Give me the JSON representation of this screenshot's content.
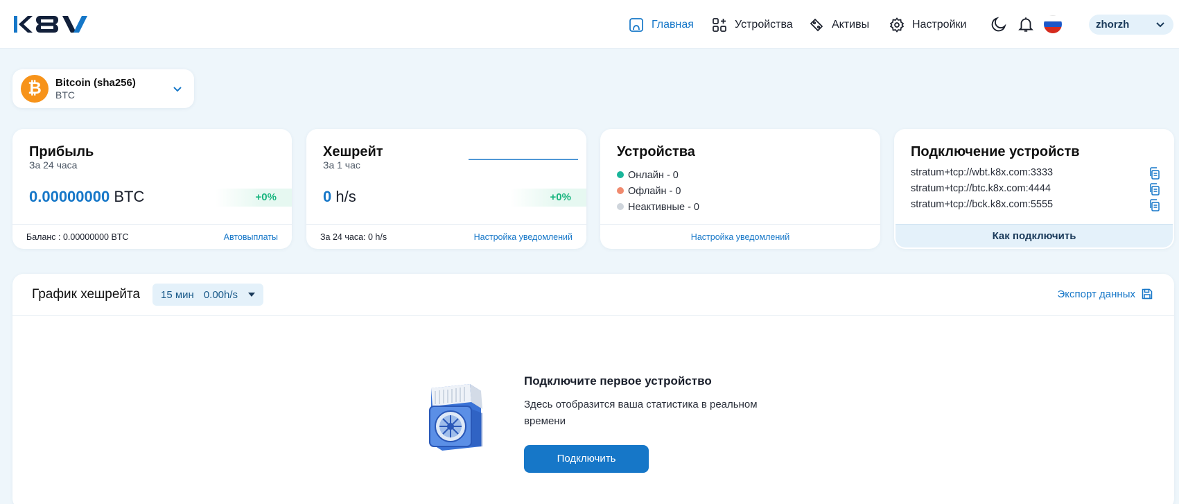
{
  "header": {
    "nav": [
      {
        "label": "Главная",
        "icon": "home-icon",
        "active": true
      },
      {
        "label": "Устройства",
        "icon": "devices-icon"
      },
      {
        "label": "Активы",
        "icon": "assets-icon"
      },
      {
        "label": "Настройки",
        "icon": "gear-icon"
      }
    ],
    "user": "zhorzh",
    "accent": "#1677c8"
  },
  "coin": {
    "name": "Bitcoin (sha256)",
    "ticker": "BTC",
    "color": "#f7931a"
  },
  "profit": {
    "title": "Прибыль",
    "period": "За 24 часа",
    "value": "0.00000000",
    "unit": "BTC",
    "change": "+0%",
    "balance": "Баланс : 0.00000000 BTC",
    "link": "Автовыплаты"
  },
  "hashrate": {
    "title": "Хешрейт",
    "period": "За 1 час",
    "value": "0",
    "unit": "h/s",
    "change": "+0%",
    "day": "За 24 часа: 0 h/s",
    "link": "Настройка уведомлений"
  },
  "devices": {
    "title": "Устройства",
    "online": "Онлайн - 0",
    "offline": "Офлайн - 0",
    "inactive": "Неактивные - 0",
    "link": "Настройка уведомлений",
    "colors": {
      "online": "#19b59a",
      "offline": "#f08a6e",
      "inactive": "#cfd5dc"
    }
  },
  "connect": {
    "title": "Подключение устройств",
    "urls": [
      "stratum+tcp://wbt.k8x.com:3333",
      "stratum+tcp://btc.k8x.com:4444",
      "stratum+tcp://bck.k8x.com:5555"
    ],
    "how": "Как подключить"
  },
  "chart": {
    "title": "График хешрейта",
    "range": "15 мин",
    "range_value": "0.00h/s",
    "export": "Экспорт данных"
  },
  "empty": {
    "title": "Подключите первое устройство",
    "desc": "Здесь отобразится ваша статистика в реальном времени",
    "button": "Подключить"
  }
}
